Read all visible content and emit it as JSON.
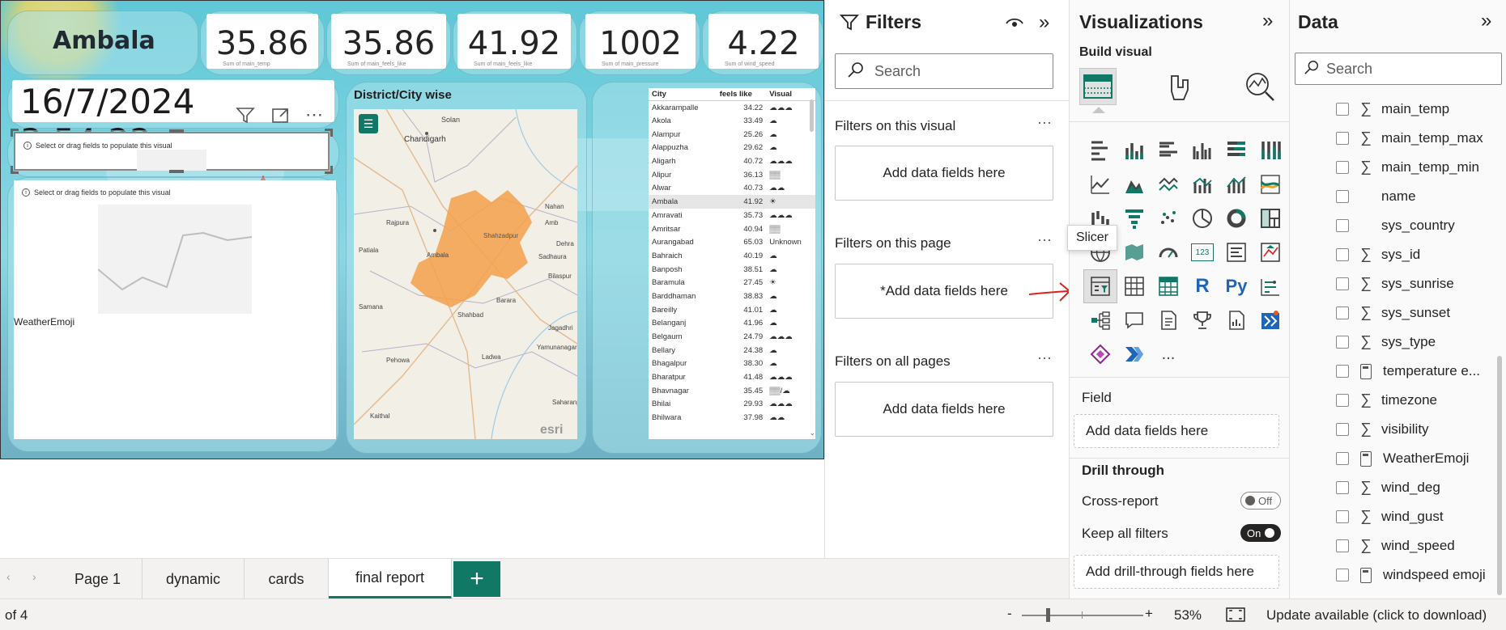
{
  "report": {
    "city": "Ambala",
    "cards": [
      "35.86",
      "35.86",
      "41.92",
      "1002",
      "4.22"
    ],
    "card_sublabels": [
      "Sum of main_temp",
      "Sum of main_feels_like",
      "Sum of main_feels_like",
      "Sum of main_pressure",
      "Sum of wind_speed"
    ],
    "datetime": "16/7/2024 3:54:22",
    "empty_visual_msg": "Select or drag fields to populate this visual",
    "weatheremoji_label": "WeatherEmoji",
    "map_title": "District/City wise",
    "map_places": [
      "Solan",
      "Chandigarh",
      "Shahzadpur",
      "Ambala",
      "Rajpura",
      "Yamunanagar",
      "Shahbad",
      "Pehowa",
      "Ladwa",
      "Kaithal",
      "Saharanpur",
      "Amb",
      "Bilaspur",
      "Dehra",
      "Jagadhri",
      "Sadhaura",
      "Nahan",
      "Barara",
      "Samana",
      "Patiala"
    ],
    "esri": "esri",
    "table": {
      "headers": [
        "City",
        "feels like",
        "Visual"
      ],
      "rows": [
        [
          "Akkarampalle",
          "34.22",
          "☁☁☁"
        ],
        [
          "Akola",
          "33.49",
          "☁"
        ],
        [
          "Alampur",
          "25.26",
          "☁"
        ],
        [
          "Alappuzha",
          "29.62",
          "☁"
        ],
        [
          "Aligarh",
          "40.72",
          "☁☁☁"
        ],
        [
          "Alipur",
          "36.13",
          "▒▒"
        ],
        [
          "Alwar",
          "40.73",
          "☁☁"
        ],
        [
          "Ambala",
          "41.92",
          "☀"
        ],
        [
          "Amravati",
          "35.73",
          "☁☁☁"
        ],
        [
          "Amritsar",
          "40.94",
          "▒▒"
        ],
        [
          "Aurangabad",
          "65.03",
          "Unknown"
        ],
        [
          "Bahraich",
          "40.19",
          "☁"
        ],
        [
          "Banposh",
          "38.51",
          "☁"
        ],
        [
          "Baramula",
          "27.45",
          "☀"
        ],
        [
          "Barddhaman",
          "38.83",
          "☁"
        ],
        [
          "Bareilly",
          "41.01",
          "☁"
        ],
        [
          "Belanganj",
          "41.96",
          "☁"
        ],
        [
          "Belgaum",
          "24.79",
          "☁☁☁"
        ],
        [
          "Bellary",
          "24.38",
          "☁"
        ],
        [
          "Bhagalpur",
          "38.30",
          "☁"
        ],
        [
          "Bharatpur",
          "41.48",
          "☁☁☁"
        ],
        [
          "Bhavnagar",
          "35.45",
          "▒▒/☁"
        ],
        [
          "Bhilai",
          "29.93",
          "☁☁☁"
        ],
        [
          "Bhilwara",
          "37.98",
          "☁☁"
        ]
      ]
    }
  },
  "filters": {
    "title": "Filters",
    "search_placeholder": "Search",
    "on_visual": "Filters on this visual",
    "on_page": "Filters on this page",
    "on_all": "Filters on all pages",
    "add_fields": "Add data fields here",
    "add_fields_page": "*Add data fields here"
  },
  "viz": {
    "title": "Visualizations",
    "build": "Build visual",
    "tooltip": "Slicer",
    "field_label": "Field",
    "add_fields": "Add data fields here",
    "drill": "Drill through",
    "cross_report": "Cross-report",
    "cross_report_state": "Off",
    "keep_filters": "Keep all filters",
    "keep_filters_state": "On",
    "add_drill": "Add drill-through fields here",
    "icon_R": "R",
    "icon_Py": "Py",
    "icon_123": "123",
    "more": "..."
  },
  "data": {
    "title": "Data",
    "search_placeholder": "Search",
    "fields": [
      {
        "name": "main_temp",
        "type": "sigma"
      },
      {
        "name": "main_temp_max",
        "type": "sigma"
      },
      {
        "name": "main_temp_min",
        "type": "sigma"
      },
      {
        "name": "name",
        "type": "text"
      },
      {
        "name": "sys_country",
        "type": "text"
      },
      {
        "name": "sys_id",
        "type": "sigma"
      },
      {
        "name": "sys_sunrise",
        "type": "sigma"
      },
      {
        "name": "sys_sunset",
        "type": "sigma"
      },
      {
        "name": "sys_type",
        "type": "sigma"
      },
      {
        "name": "temperature e...",
        "type": "calc"
      },
      {
        "name": "timezone",
        "type": "sigma"
      },
      {
        "name": "visibility",
        "type": "sigma"
      },
      {
        "name": "WeatherEmoji",
        "type": "calc"
      },
      {
        "name": "wind_deg",
        "type": "sigma"
      },
      {
        "name": "wind_gust",
        "type": "sigma"
      },
      {
        "name": "wind_speed",
        "type": "sigma"
      },
      {
        "name": "windspeed emoji",
        "type": "calc"
      }
    ]
  },
  "tabs": [
    "Page 1",
    "dynamic",
    "cards",
    "final report"
  ],
  "status": {
    "page": "of 4",
    "zoom": "53%",
    "minus": "-",
    "plus": "+",
    "update": "Update available (click to download)"
  },
  "colors": {
    "accent": "#117865",
    "map_region": "#f5a04a",
    "annotation": "#e0201a"
  }
}
